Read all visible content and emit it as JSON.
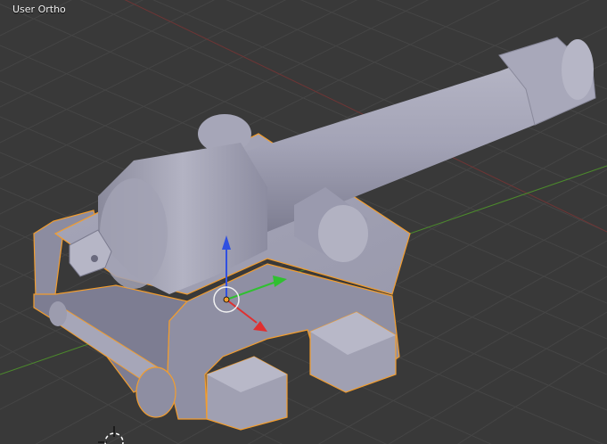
{
  "viewport": {
    "view_label": "User Ortho",
    "background_color": "#393939",
    "grid_color": "#454545",
    "x_axis_color": "#7a3a3a",
    "y_axis_color": "#4c8a2c",
    "selection_outline_color": "#f29d2e"
  },
  "scene": {
    "object": "cannon",
    "selected": true,
    "transform_manipulator": {
      "axes": [
        "x",
        "y",
        "z"
      ],
      "x_color": "#e03030",
      "y_color": "#30c030",
      "z_color": "#3050e0"
    },
    "icons": [
      "3d-cursor-icon",
      "object-origin-icon"
    ]
  }
}
